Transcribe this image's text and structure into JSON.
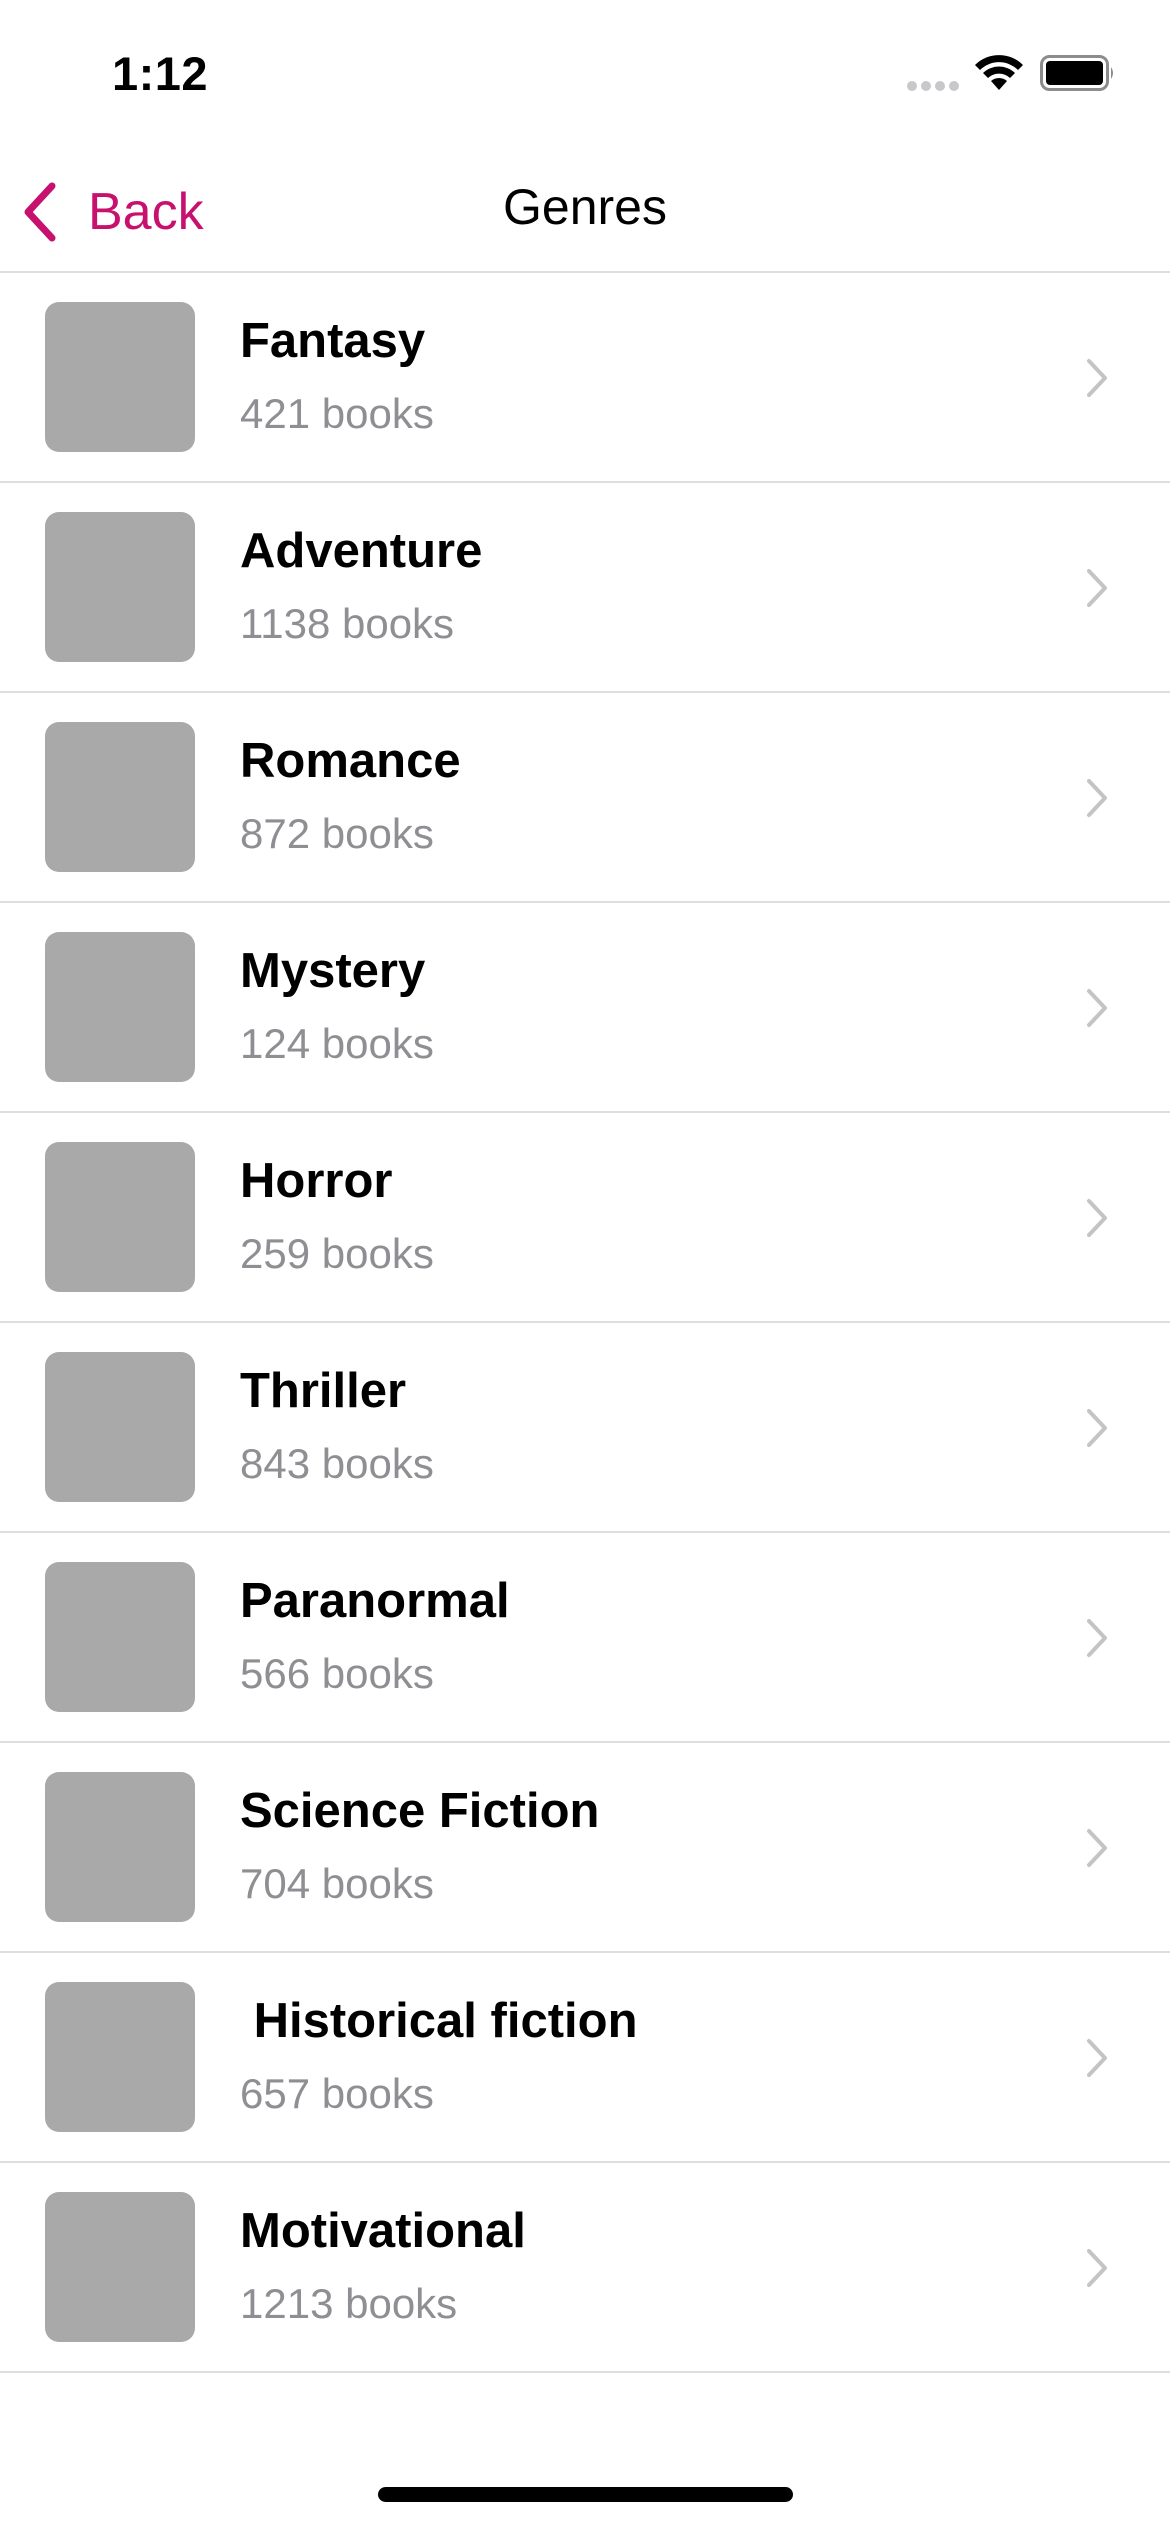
{
  "status_bar": {
    "time": "1:12",
    "icons": [
      "signal-icon",
      "wifi-icon",
      "battery-icon"
    ]
  },
  "nav": {
    "back_label": "Back",
    "title": "Genres",
    "accent_color": "#c8106e"
  },
  "genres": [
    {
      "name": "Fantasy",
      "count": "421 books"
    },
    {
      "name": "Adventure",
      "count": "1138 books"
    },
    {
      "name": "Romance",
      "count": "872 books"
    },
    {
      "name": "Mystery",
      "count": "124 books"
    },
    {
      "name": "Horror",
      "count": "259 books"
    },
    {
      "name": "Thriller",
      "count": "843 books"
    },
    {
      "name": "Paranormal",
      "count": "566 books"
    },
    {
      "name": "Science Fiction",
      "count": "704 books"
    },
    {
      "name": " Historical fiction",
      "count": "657 books"
    },
    {
      "name": "Motivational",
      "count": "1213 books"
    }
  ]
}
